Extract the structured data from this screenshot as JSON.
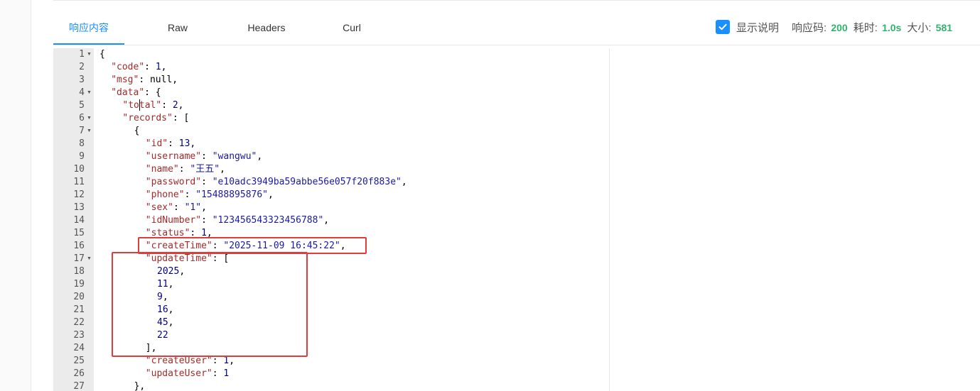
{
  "tabs": [
    {
      "label": "响应内容",
      "active": true
    },
    {
      "label": "Raw",
      "active": false
    },
    {
      "label": "Headers",
      "active": false
    },
    {
      "label": "Curl",
      "active": false
    }
  ],
  "status": {
    "show_desc_label": "显示说明",
    "show_desc_checked": true,
    "code_label": "响应码:",
    "code_value": "200",
    "time_label": "耗时:",
    "time_value": "1.0s",
    "size_label": "大小:",
    "size_value": "581"
  },
  "code_lines": [
    {
      "n": "1",
      "fold": true,
      "indent": 0,
      "tokens": [
        [
          "p",
          "{"
        ]
      ]
    },
    {
      "n": "2",
      "fold": false,
      "indent": 2,
      "tokens": [
        [
          "k",
          "\"code\""
        ],
        [
          "p",
          ": "
        ],
        [
          "n",
          "1"
        ],
        [
          "p",
          ","
        ]
      ]
    },
    {
      "n": "3",
      "fold": false,
      "indent": 2,
      "tokens": [
        [
          "k",
          "\"msg\""
        ],
        [
          "p",
          ": "
        ],
        [
          "p",
          "null"
        ],
        [
          "p",
          ","
        ]
      ]
    },
    {
      "n": "4",
      "fold": true,
      "indent": 2,
      "tokens": [
        [
          "k",
          "\"data\""
        ],
        [
          "p",
          ": {"
        ]
      ]
    },
    {
      "n": "5",
      "fold": false,
      "indent": 4,
      "tokens": [
        [
          "k",
          "\"total\""
        ],
        [
          "p",
          ": "
        ],
        [
          "n",
          "2"
        ],
        [
          "p",
          ","
        ]
      ]
    },
    {
      "n": "6",
      "fold": true,
      "indent": 4,
      "tokens": [
        [
          "k",
          "\"records\""
        ],
        [
          "p",
          ": ["
        ]
      ]
    },
    {
      "n": "7",
      "fold": true,
      "indent": 6,
      "tokens": [
        [
          "p",
          "{"
        ]
      ]
    },
    {
      "n": "8",
      "fold": false,
      "indent": 8,
      "tokens": [
        [
          "k",
          "\"id\""
        ],
        [
          "p",
          ": "
        ],
        [
          "n",
          "13"
        ],
        [
          "p",
          ","
        ]
      ]
    },
    {
      "n": "9",
      "fold": false,
      "indent": 8,
      "tokens": [
        [
          "k",
          "\"username\""
        ],
        [
          "p",
          ": "
        ],
        [
          "s",
          "\"wangwu\""
        ],
        [
          "p",
          ","
        ]
      ]
    },
    {
      "n": "10",
      "fold": false,
      "indent": 8,
      "tokens": [
        [
          "k",
          "\"name\""
        ],
        [
          "p",
          ": "
        ],
        [
          "s",
          "\"王五\""
        ],
        [
          "p",
          ","
        ]
      ]
    },
    {
      "n": "11",
      "fold": false,
      "indent": 8,
      "tokens": [
        [
          "k",
          "\"password\""
        ],
        [
          "p",
          ": "
        ],
        [
          "s",
          "\"e10adc3949ba59abbe56e057f20f883e\""
        ],
        [
          "p",
          ","
        ]
      ]
    },
    {
      "n": "12",
      "fold": false,
      "indent": 8,
      "tokens": [
        [
          "k",
          "\"phone\""
        ],
        [
          "p",
          ": "
        ],
        [
          "s",
          "\"15488895876\""
        ],
        [
          "p",
          ","
        ]
      ]
    },
    {
      "n": "13",
      "fold": false,
      "indent": 8,
      "tokens": [
        [
          "k",
          "\"sex\""
        ],
        [
          "p",
          ": "
        ],
        [
          "s",
          "\"1\""
        ],
        [
          "p",
          ","
        ]
      ]
    },
    {
      "n": "14",
      "fold": false,
      "indent": 8,
      "tokens": [
        [
          "k",
          "\"idNumber\""
        ],
        [
          "p",
          ": "
        ],
        [
          "s",
          "\"123456543323456788\""
        ],
        [
          "p",
          ","
        ]
      ]
    },
    {
      "n": "15",
      "fold": false,
      "indent": 8,
      "tokens": [
        [
          "k",
          "\"status\""
        ],
        [
          "p",
          ": "
        ],
        [
          "n",
          "1"
        ],
        [
          "p",
          ","
        ]
      ]
    },
    {
      "n": "16",
      "fold": false,
      "indent": 8,
      "tokens": [
        [
          "k",
          "\"createTime\""
        ],
        [
          "p",
          ": "
        ],
        [
          "s",
          "\"2025-11-09 16:45:22\""
        ],
        [
          "p",
          ","
        ]
      ]
    },
    {
      "n": "17",
      "fold": true,
      "indent": 8,
      "tokens": [
        [
          "k",
          "\"updateTime\""
        ],
        [
          "p",
          ": ["
        ]
      ]
    },
    {
      "n": "18",
      "fold": false,
      "indent": 10,
      "tokens": [
        [
          "n",
          "2025"
        ],
        [
          "p",
          ","
        ]
      ]
    },
    {
      "n": "19",
      "fold": false,
      "indent": 10,
      "tokens": [
        [
          "n",
          "11"
        ],
        [
          "p",
          ","
        ]
      ]
    },
    {
      "n": "20",
      "fold": false,
      "indent": 10,
      "tokens": [
        [
          "n",
          "9"
        ],
        [
          "p",
          ","
        ]
      ]
    },
    {
      "n": "21",
      "fold": false,
      "indent": 10,
      "tokens": [
        [
          "n",
          "16"
        ],
        [
          "p",
          ","
        ]
      ]
    },
    {
      "n": "22",
      "fold": false,
      "indent": 10,
      "tokens": [
        [
          "n",
          "45"
        ],
        [
          "p",
          ","
        ]
      ]
    },
    {
      "n": "23",
      "fold": false,
      "indent": 10,
      "tokens": [
        [
          "n",
          "22"
        ]
      ]
    },
    {
      "n": "24",
      "fold": false,
      "indent": 8,
      "tokens": [
        [
          "p",
          "],"
        ]
      ]
    },
    {
      "n": "25",
      "fold": false,
      "indent": 8,
      "tokens": [
        [
          "k",
          "\"createUser\""
        ],
        [
          "p",
          ": "
        ],
        [
          "n",
          "1"
        ],
        [
          "p",
          ","
        ]
      ]
    },
    {
      "n": "26",
      "fold": false,
      "indent": 8,
      "tokens": [
        [
          "k",
          "\"updateUser\""
        ],
        [
          "p",
          ": "
        ],
        [
          "n",
          "1"
        ]
      ]
    },
    {
      "n": "27",
      "fold": false,
      "indent": 6,
      "tokens": [
        [
          "p",
          "},"
        ]
      ]
    }
  ],
  "colors": {
    "accent": "#1890ff",
    "status_value": "#2fb36b",
    "highlight_box": "#e03c3c"
  }
}
